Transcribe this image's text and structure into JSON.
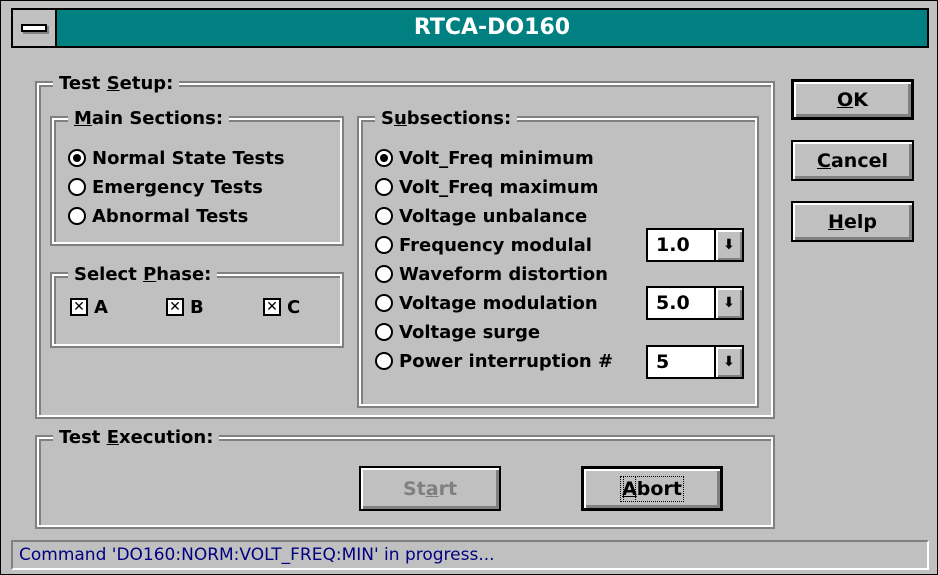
{
  "window": {
    "title": "RTCA-DO160"
  },
  "test_setup": {
    "label_pre": "Test ",
    "label_key": "S",
    "label_post": "etup:",
    "main_sections": {
      "label_pre": "",
      "label_key": "M",
      "label_post": "ain Sections:",
      "options": [
        {
          "label": "Normal State Tests",
          "checked": true
        },
        {
          "label": "Emergency Tests",
          "checked": false
        },
        {
          "label": "Abnormal Tests",
          "checked": false
        }
      ]
    },
    "select_phase": {
      "label_pre": "Select ",
      "label_key": "P",
      "label_post": "hase:",
      "phases": [
        {
          "label": "A",
          "checked": true,
          "mark": "✕"
        },
        {
          "label": "B",
          "checked": true,
          "mark": "✕"
        },
        {
          "label": "C",
          "checked": true,
          "mark": "✕"
        }
      ]
    },
    "subsections": {
      "label_pre": "S",
      "label_key": "u",
      "label_post": "bsections:",
      "options": [
        {
          "label": "Volt_Freq minimum",
          "checked": true
        },
        {
          "label": "Volt_Freq maximum",
          "checked": false
        },
        {
          "label": "Voltage unbalance",
          "checked": false
        },
        {
          "label": "Frequency modulal",
          "checked": false
        },
        {
          "label": "Waveform distortion",
          "checked": false
        },
        {
          "label": "Voltage modulation",
          "checked": false
        },
        {
          "label": "Voltage surge",
          "checked": false
        },
        {
          "label": "Power interruption #",
          "checked": false
        }
      ],
      "combos": {
        "frequency_modulation": "1.0",
        "voltage_modulation": "5.0",
        "power_interruption": "5"
      },
      "combo_arrow": "⬇"
    }
  },
  "test_execution": {
    "label_pre": "Test ",
    "label_key": "E",
    "label_post": "xecution:",
    "start": {
      "pre": "St",
      "key": "a",
      "post": "rt"
    },
    "abort": {
      "pre": "",
      "key": "A",
      "post": "bort"
    }
  },
  "buttons": {
    "ok": {
      "pre": "",
      "key": "O",
      "post": "K"
    },
    "cancel": {
      "pre": "",
      "key": "C",
      "post": "ancel"
    },
    "help": {
      "pre": "",
      "key": "H",
      "post": "elp"
    }
  },
  "status": "Command 'DO160:NORM:VOLT_FREQ:MIN' in progress..."
}
